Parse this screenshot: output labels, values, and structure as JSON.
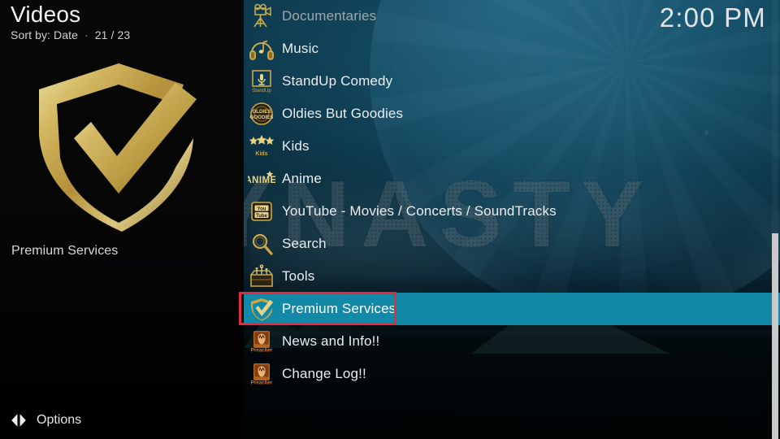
{
  "header": {
    "title": "Videos",
    "sort_label": "Sort by:",
    "sort_value": "Date",
    "separator": "·",
    "position": "21 / 23",
    "clock": "2:00 PM"
  },
  "thumbnail": {
    "label": "Premium Services",
    "icon": "gold-shield-check-icon"
  },
  "footer": {
    "options_label": "Options",
    "options_icon": "left-right-arrows-icon"
  },
  "watermark": {
    "text": "DYNASTY"
  },
  "colors": {
    "highlight": "#1389a8",
    "annotation": "#e8283c",
    "gold": "#c8a84b",
    "panel": "#050506",
    "scrollbar": "#c9c9c9"
  },
  "menu": {
    "selected_index": 9,
    "items": [
      {
        "label": "Documentaries",
        "icon": "film-camera-tripod-icon",
        "dim": true
      },
      {
        "label": "Music",
        "icon": "headphones-note-icon",
        "dim": false
      },
      {
        "label": "StandUp Comedy",
        "icon": "microphone-stage-icon",
        "dim": false
      },
      {
        "label": "Oldies But Goodies",
        "icon": "oldies-badge-icon",
        "dim": false
      },
      {
        "label": "Kids",
        "icon": "kids-stars-icon",
        "dim": false
      },
      {
        "label": "Anime",
        "icon": "anime-text-icon",
        "dim": false
      },
      {
        "label": "YouTube - Movies / Concerts / SoundTracks",
        "icon": "youtube-badge-icon",
        "dim": false
      },
      {
        "label": "Search",
        "icon": "magnifier-icon",
        "dim": false
      },
      {
        "label": "Tools",
        "icon": "toolbox-icon",
        "dim": false
      },
      {
        "label": "Premium Services",
        "icon": "gold-shield-check-icon",
        "dim": false
      },
      {
        "label": "News and Info!!",
        "icon": "preacher-poster-icon",
        "dim": false
      },
      {
        "label": "Change Log!!",
        "icon": "preacher-poster-icon",
        "dim": false
      }
    ]
  },
  "scrollbar": {
    "visible": true
  }
}
